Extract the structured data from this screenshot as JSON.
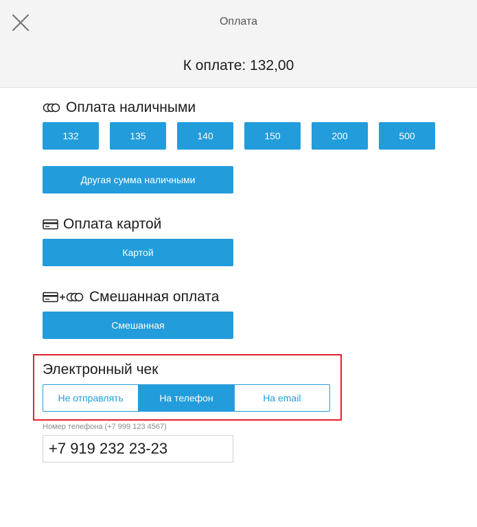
{
  "header": {
    "title": "Оплата",
    "amount_due": "К оплате: 132,00"
  },
  "cash": {
    "title": "Оплата наличными",
    "icon": "coins-icon",
    "amounts": [
      "132",
      "135",
      "140",
      "150",
      "200",
      "500"
    ],
    "other_label": "Другая сумма наличными"
  },
  "card": {
    "title": "Оплата картой",
    "icon": "card-icon",
    "button_label": "Картой"
  },
  "mixed": {
    "title": "Смешанная оплата",
    "icon": "card-plus-coins-icon",
    "button_label": "Смешанная"
  },
  "receipt": {
    "title": "Электронный чек",
    "options": [
      "Не отправлять",
      "На телефон",
      "На email"
    ],
    "selected": "На телефон",
    "phone_label": "Номер телефона (+7 999 123 4567)",
    "phone_value": "+7 919 232 23-23"
  },
  "colors": {
    "accent": "#229cdb",
    "highlight_border": "#e2202a",
    "header_bg": "#f4f4f4"
  }
}
